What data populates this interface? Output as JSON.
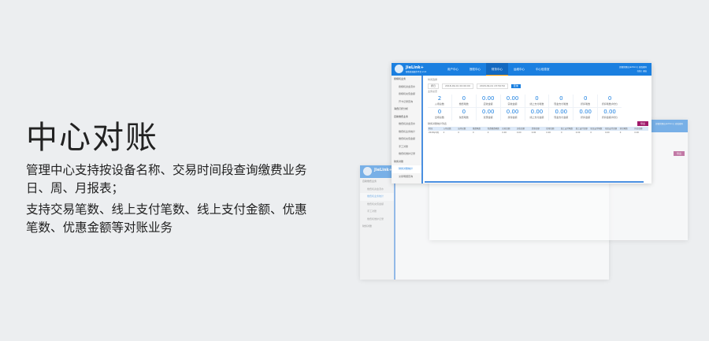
{
  "heading": "中心对账",
  "description": [
    "管理中心支持按设备名称、交易时间段查询缴费业务日、周、月报表；",
    "支持交易笔数、线上支付笔数、线上支付金额、优惠笔数、优惠金额等对账业务"
  ],
  "app": {
    "brand": "JieLink+",
    "brand_sub": "智能终端操作平台 v1.0",
    "nav": [
      "用户中心",
      "授权中心",
      "财务中心",
      "运维中心",
      "中心信息室"
    ],
    "active_nav": 2,
    "user_line1": "超级管理员(admin) | 修改密码",
    "user_line2": "在线 | 退出",
    "sidebar": [
      {
        "label": "授権机业务",
        "group": true
      },
      {
        "label": "授権机资金流水"
      },
      {
        "label": "授権机充值金额"
      },
      {
        "label": "开卡记录查询"
      },
      {
        "label": "消费打折分析",
        "group": true
      },
      {
        "label": "自助缴费业务",
        "group": true
      },
      {
        "label": "缴费机资金流水"
      },
      {
        "label": "缴费机业务统计"
      },
      {
        "label": "缴费机充值金额"
      },
      {
        "label": "手工对账"
      },
      {
        "label": "缴费机维护记录"
      },
      {
        "label": "财务对账",
        "group": true
      },
      {
        "label": "财务对账统计",
        "active": true
      },
      {
        "label": "交易明细查询"
      }
    ],
    "time_section": "时间选择",
    "period": "按日",
    "start": "2018-09-01 00:00:00",
    "end": "2018-09-01 23:59:59",
    "query": "查询",
    "summary_section": "业务总览",
    "cards": [
      {
        "v": "2",
        "l": "入场总数"
      },
      {
        "v": "0",
        "l": "缴费笔数"
      },
      {
        "v": "0.00",
        "l": "应收金额"
      },
      {
        "v": "0.00",
        "l": "实收金额"
      },
      {
        "v": "0",
        "l": "线上支付笔数"
      },
      {
        "v": "0",
        "l": "现金支付笔数"
      },
      {
        "v": "0",
        "l": "折扣笔数"
      },
      {
        "v": "0",
        "l": "折扣笔数(时长)"
      },
      {
        "v": "0",
        "l": "出场总数"
      },
      {
        "v": "0",
        "l": "免费笔数"
      },
      {
        "v": "0.00",
        "l": "优惠金额"
      },
      {
        "v": "0.00",
        "l": "找零金额"
      },
      {
        "v": "0.00",
        "l": "线上支付金额"
      },
      {
        "v": "0.00",
        "l": "现金支付金额"
      },
      {
        "v": "0.00",
        "l": "折扣金额"
      },
      {
        "v": "0.00",
        "l": "折扣金额(时长)"
      }
    ],
    "list_title": "财务对账统计列表",
    "export": "导出",
    "columns": [
      "时间",
      "入场总数",
      "出场总数",
      "缴费笔数",
      "免费缴费笔数",
      "应收金额",
      "实收金额",
      "优惠金额",
      "找零金额",
      "线上支付笔数",
      "线上支付金额",
      "现金支付笔数",
      "现金支付金额",
      "折扣笔数",
      "折扣金额"
    ],
    "row": [
      "2018年8月",
      "2",
      "0",
      "0",
      "0",
      "0.00",
      "0.00",
      "0.00",
      "0.00",
      "0",
      "0.00",
      "0",
      "0.00",
      "0",
      "0.00"
    ]
  }
}
